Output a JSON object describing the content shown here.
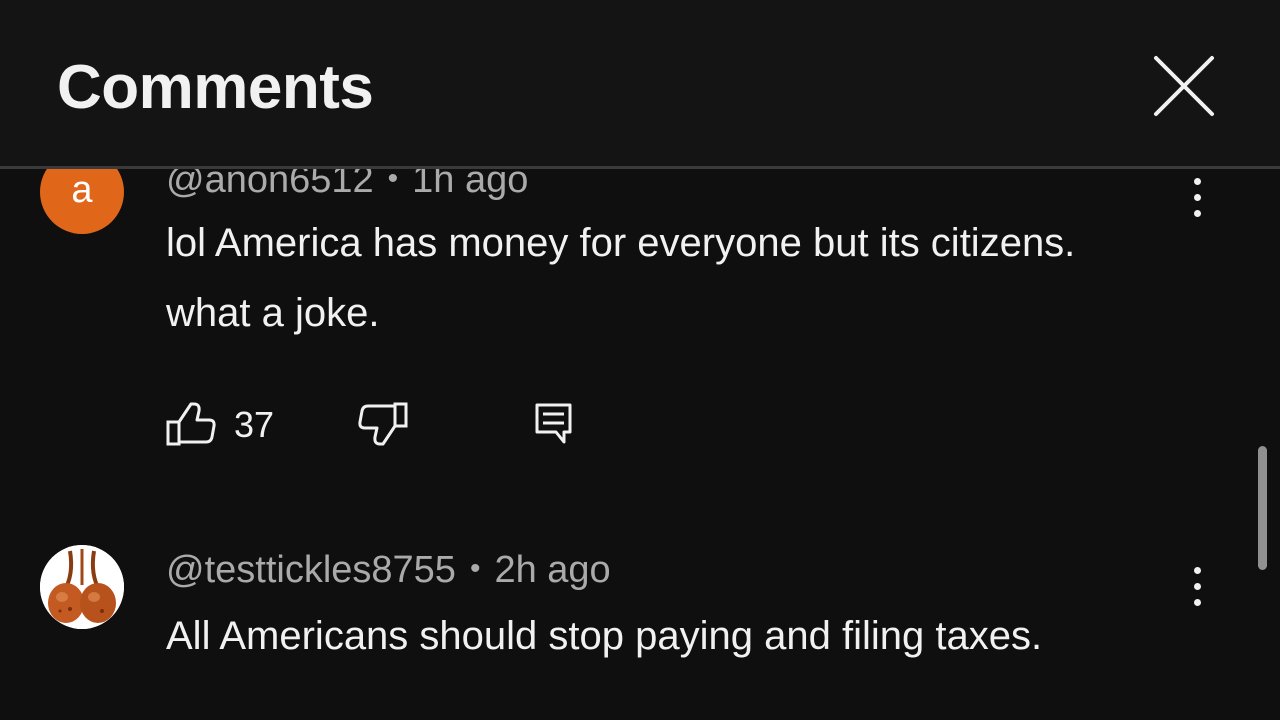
{
  "header": {
    "title": "Comments"
  },
  "comments": [
    {
      "avatar_letter": "a",
      "avatar_color": "#e0671a",
      "author": "@anon6512",
      "time": "1h ago",
      "text": "lol America has money for everyone but its citizens. what a joke.",
      "like_count": "37"
    },
    {
      "author": "@testtickles8755",
      "time": "2h ago",
      "text": "All Americans should stop paying and filing taxes."
    }
  ],
  "icons": {
    "close": "close-icon",
    "more": "more-vertical-icon",
    "like": "thumbs-up-icon",
    "dislike": "thumbs-down-icon",
    "reply": "reply-icon"
  }
}
